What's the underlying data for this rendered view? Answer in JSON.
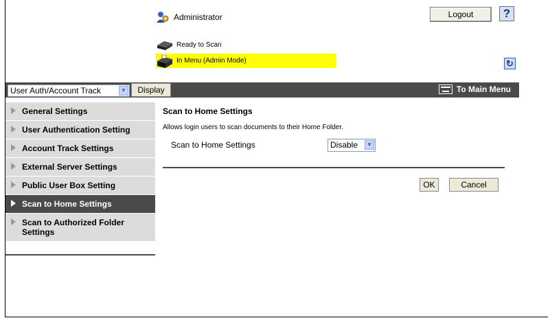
{
  "header": {
    "user_label": "Administrator",
    "logout_label": "Logout",
    "help_label": "?",
    "status_ready": "Ready to Scan",
    "status_menu": "In Menu (Admin Mode)",
    "refresh_icon": "refresh-icon",
    "status_highlight_color": "#ffff00"
  },
  "toolbar": {
    "select_value": "User Auth/Account Track",
    "display_label": "Display",
    "to_main_label": "To Main Menu"
  },
  "sidebar": {
    "items": [
      {
        "label": "General Settings"
      },
      {
        "label": "User Authentication Setting"
      },
      {
        "label": "Account Track Settings"
      },
      {
        "label": "External Server Settings"
      },
      {
        "label": "Public User Box Setting"
      },
      {
        "label": "Scan to Home Settings",
        "active": true
      },
      {
        "label": "Scan to Authorized Folder Settings"
      }
    ]
  },
  "main": {
    "title": "Scan to Home Settings",
    "description": "Allows login users to scan documents to their Home Folder.",
    "field_label": "Scan to Home Settings",
    "field_value": "Disable",
    "ok_label": "OK",
    "cancel_label": "Cancel"
  },
  "colors": {
    "bar_dark": "#4a4a4a",
    "sidebar_bg": "#dcdcdc"
  }
}
